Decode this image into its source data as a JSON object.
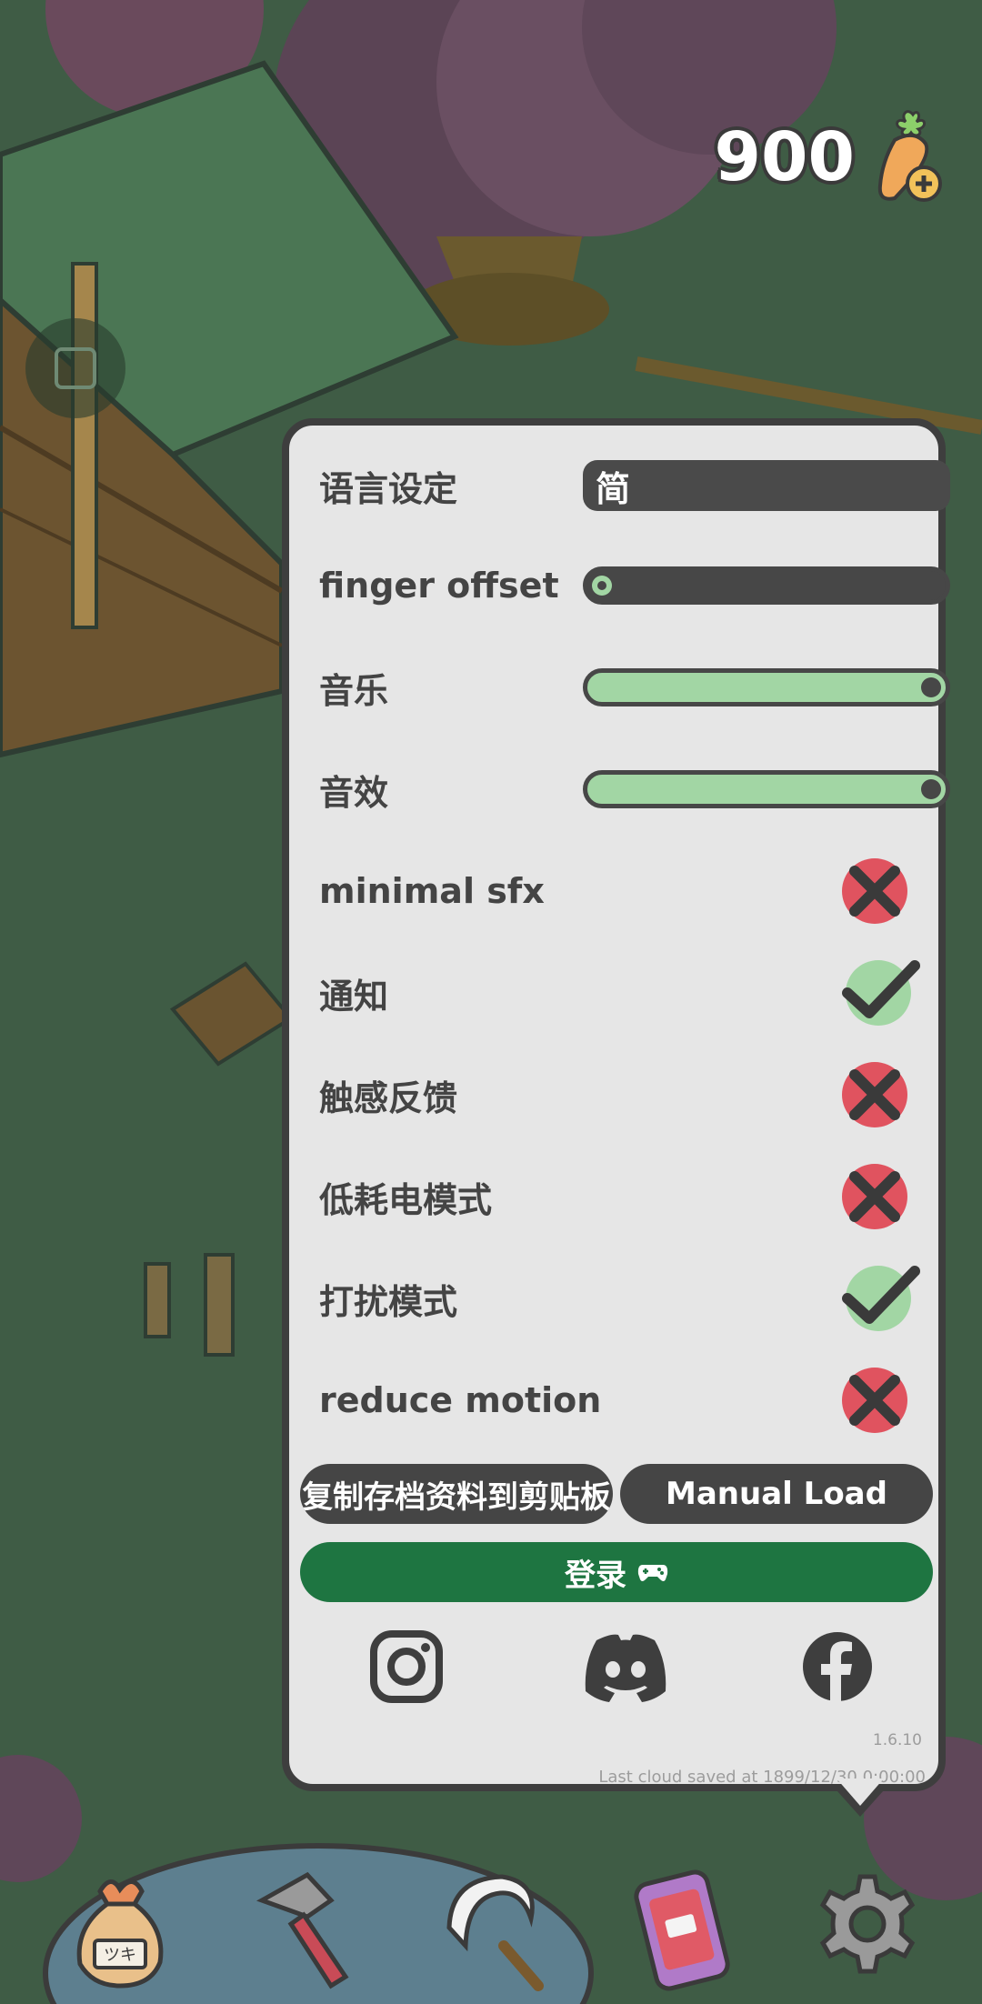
{
  "currency": {
    "amount": "900",
    "icon": "carrot-plus-icon"
  },
  "settings": {
    "language": {
      "label": "语言设定",
      "value": "简"
    },
    "finger_offset": {
      "label": "finger offset",
      "level": 0
    },
    "music": {
      "label": "音乐",
      "level": 1.0
    },
    "sfx": {
      "label": "音效",
      "level": 1.0
    },
    "minimal_sfx": {
      "label": "minimal sfx",
      "enabled": false
    },
    "notifications": {
      "label": "通知",
      "enabled": true
    },
    "haptics": {
      "label": "触感反馈",
      "enabled": false
    },
    "low_power": {
      "label": "低耗电模式",
      "enabled": false
    },
    "dnd": {
      "label": "打扰模式",
      "enabled": true
    },
    "reduce_motion": {
      "label": "reduce motion",
      "enabled": false
    }
  },
  "buttons": {
    "copy_save": "复制存档资料到剪贴板",
    "manual_load": "Manual Load",
    "login": "登录"
  },
  "socials": [
    "instagram-icon",
    "discord-icon",
    "facebook-icon"
  ],
  "footer": {
    "version": "1.6.10",
    "last_saved": "Last cloud saved at 1899/12/30 0:00:00"
  },
  "bottom_nav": [
    "seed-bag-icon",
    "hammer-icon",
    "sickle-icon",
    "phone-icon",
    "gear-icon"
  ],
  "colors": {
    "panel": "#e6e6e6",
    "toggle_on": "#a2d6a4",
    "toggle_off": "#e0535f",
    "login": "#1e7541",
    "dark": "#454545"
  }
}
